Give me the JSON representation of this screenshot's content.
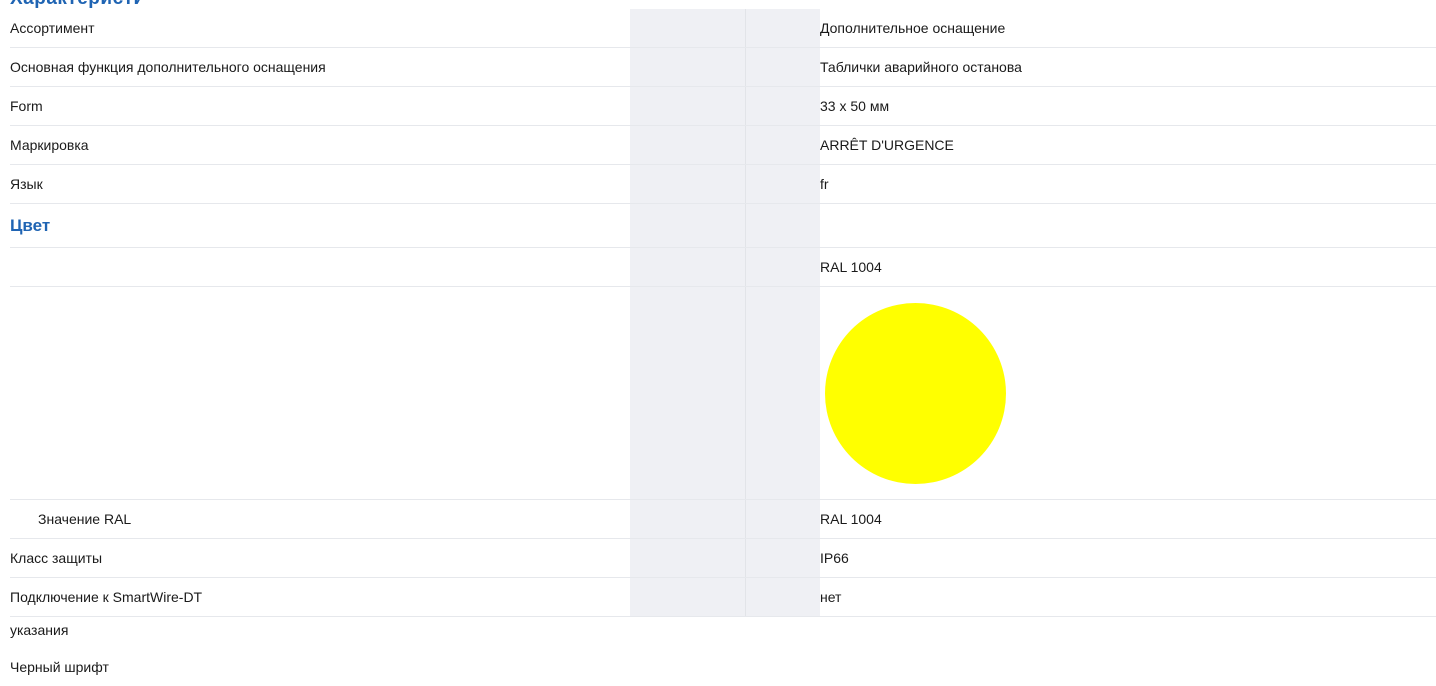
{
  "section_title": "Характеристики",
  "rows": [
    {
      "label": "Ассортимент",
      "value": "Дополнительное оснащение"
    },
    {
      "label": "Основная функция дополнительного оснащения",
      "value": "Таблички аварийного останова"
    },
    {
      "label": "Form",
      "value": "33 x 50 мм"
    },
    {
      "label": "Маркировка",
      "value": "ARRÊT D'URGENCE"
    },
    {
      "label": "Язык",
      "value": "fr"
    }
  ],
  "color_group": {
    "title": "Цвет",
    "ral_top": "RAL 1004",
    "swatch_color": "#ffff00",
    "ral_label": "Значение RAL",
    "ral_value": "RAL 1004"
  },
  "rows_after": [
    {
      "label": "Класс защиты",
      "value": "IP66"
    },
    {
      "label": "Подключение к SmartWire-DT",
      "value": "нет"
    }
  ],
  "notes": {
    "title": "указания",
    "text": "Черный шрифт"
  }
}
